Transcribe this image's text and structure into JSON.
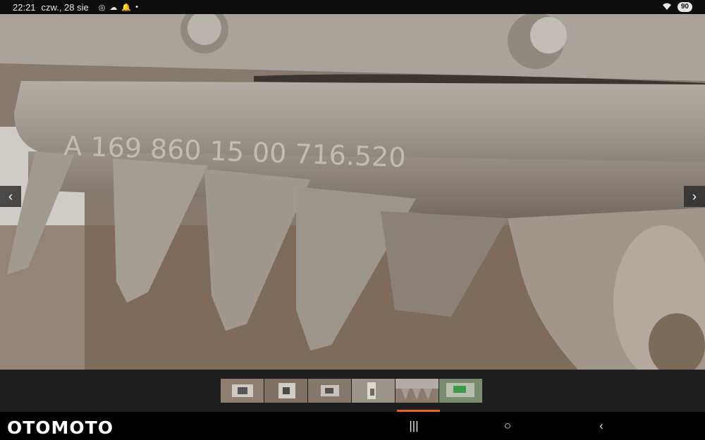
{
  "status_bar": {
    "time": "22:21",
    "date": "czw., 28 sie",
    "icons": [
      "chrome-icon",
      "cloud-icon",
      "bell-icon",
      "dot-icon"
    ],
    "battery": "90"
  },
  "gallery": {
    "image_text": "A 169 860 15 00 716.520",
    "prev_label": "‹",
    "next_label": "›",
    "thumbnail_count": 6,
    "active_thumbnail": 6
  },
  "app": {
    "logo": "OTOMOTO"
  },
  "system_nav": {
    "recents_label": "|||",
    "home_label": "○",
    "back_label": "‹"
  },
  "colors": {
    "accent": "#e8641c",
    "status_bg": "#0e0e0e",
    "strip_bg": "#1e1e1e"
  }
}
